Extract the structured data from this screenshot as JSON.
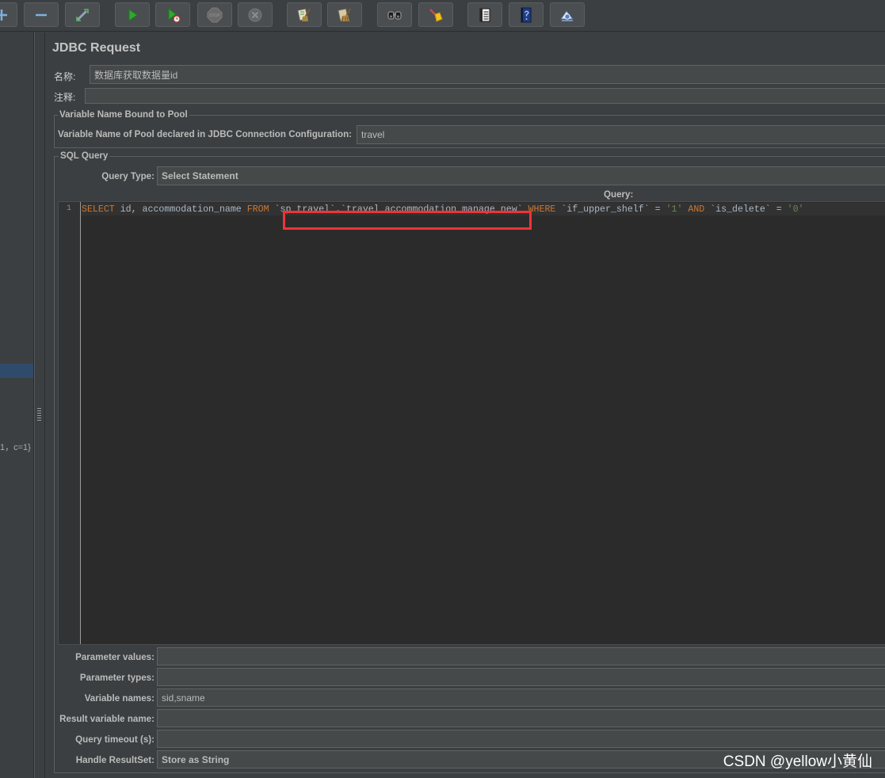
{
  "toolbar": {
    "buttons": [
      {
        "icon": "add-icon"
      },
      {
        "icon": "remove-icon"
      },
      {
        "icon": "toggle-icon"
      },
      {
        "icon": "start-icon"
      },
      {
        "icon": "start-no-pauses-icon"
      },
      {
        "icon": "stop-icon"
      },
      {
        "icon": "shutdown-icon"
      },
      {
        "icon": "clear-icon"
      },
      {
        "icon": "clear-all-icon"
      },
      {
        "icon": "search-icon"
      },
      {
        "icon": "reset-search-icon"
      },
      {
        "icon": "function-helper-icon"
      },
      {
        "icon": "help-icon"
      },
      {
        "icon": "remote-icon"
      }
    ],
    "stop_text": "STOP"
  },
  "tree": {
    "visible_text": "1，c=1}"
  },
  "form": {
    "title": "JDBC Request",
    "name": {
      "label": "名称:",
      "value": "数据库获取数据量id"
    },
    "comments": {
      "label": "注释:",
      "value": ""
    },
    "pool": {
      "legend": "Variable Name Bound to Pool",
      "label": "Variable Name of Pool declared in JDBC Connection Configuration:",
      "value": "travel"
    },
    "sql": {
      "legend": "SQL Query",
      "query_type_label": "Query Type:",
      "query_type_value": "Select Statement",
      "query_label": "Query:",
      "line_numbers": [
        "1"
      ],
      "tokens": [
        "SELECT",
        " id, accommodation_name ",
        "FROM",
        " `sp_travel`.`travel_accommodation_manage_new` ",
        "WHERE",
        " `if_upper_shelf` = ",
        "'1'",
        " ",
        "AND",
        " `is_delete` = ",
        "'0'"
      ]
    },
    "fields": [
      {
        "label": "Parameter values:",
        "value": ""
      },
      {
        "label": "Parameter types:",
        "value": ""
      },
      {
        "label": "Variable names:",
        "value": "sid,sname"
      },
      {
        "label": "Result variable name:",
        "value": ""
      },
      {
        "label": "Query timeout (s):",
        "value": ""
      },
      {
        "label": "Handle ResultSet:",
        "value": "Store as String"
      }
    ]
  },
  "watermark": "CSDN @yellow小黄仙",
  "colors": {
    "background": "#3c3f41",
    "field_bg": "#45494a",
    "editor_bg": "#2b2b2b",
    "sql_keyword": "#cc7832",
    "sql_string": "#6a8759",
    "sql_text": "#a9b7c6",
    "tree_selection": "#2f4b6c",
    "annotation_red": "#f03434"
  }
}
